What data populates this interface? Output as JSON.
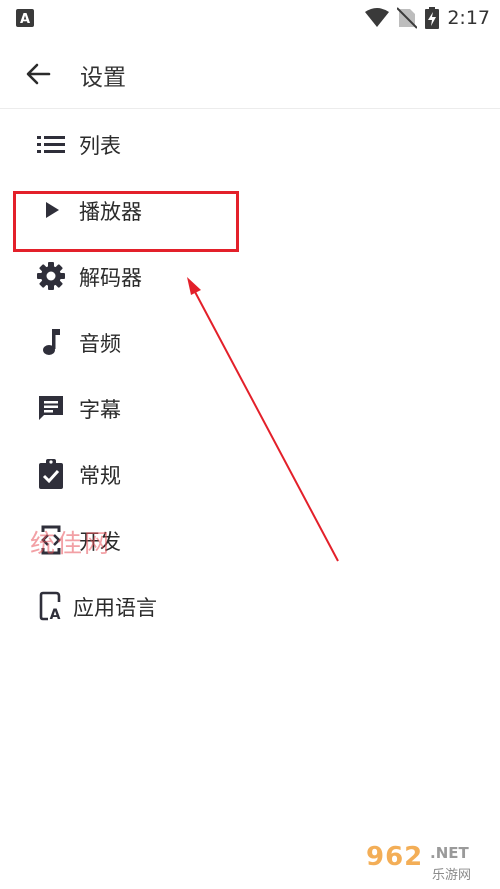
{
  "status_bar": {
    "time": "2:17",
    "app_icon": "A"
  },
  "toolbar": {
    "title": "设置"
  },
  "menu": [
    {
      "id": "list",
      "label": "列表",
      "icon": "list-icon"
    },
    {
      "id": "player",
      "label": "播放器",
      "icon": "play-icon"
    },
    {
      "id": "decoder",
      "label": "解码器",
      "icon": "gear-icon"
    },
    {
      "id": "audio",
      "label": "音频",
      "icon": "music-note-icon"
    },
    {
      "id": "subtitle",
      "label": "字幕",
      "icon": "subtitle-icon"
    },
    {
      "id": "general",
      "label": "常规",
      "icon": "clipboard-check-icon"
    },
    {
      "id": "developer",
      "label": "开发",
      "icon": "developer-icon"
    },
    {
      "id": "app_language",
      "label": "应用语言",
      "icon": "language-icon"
    }
  ],
  "watermarks": {
    "left_text": "统佳网",
    "logo_text": "962",
    "logo_net": ".NET",
    "logo_sub": "乐游网"
  },
  "colors": {
    "annotation": "#e3202a",
    "icon": "#2f2f3a"
  }
}
